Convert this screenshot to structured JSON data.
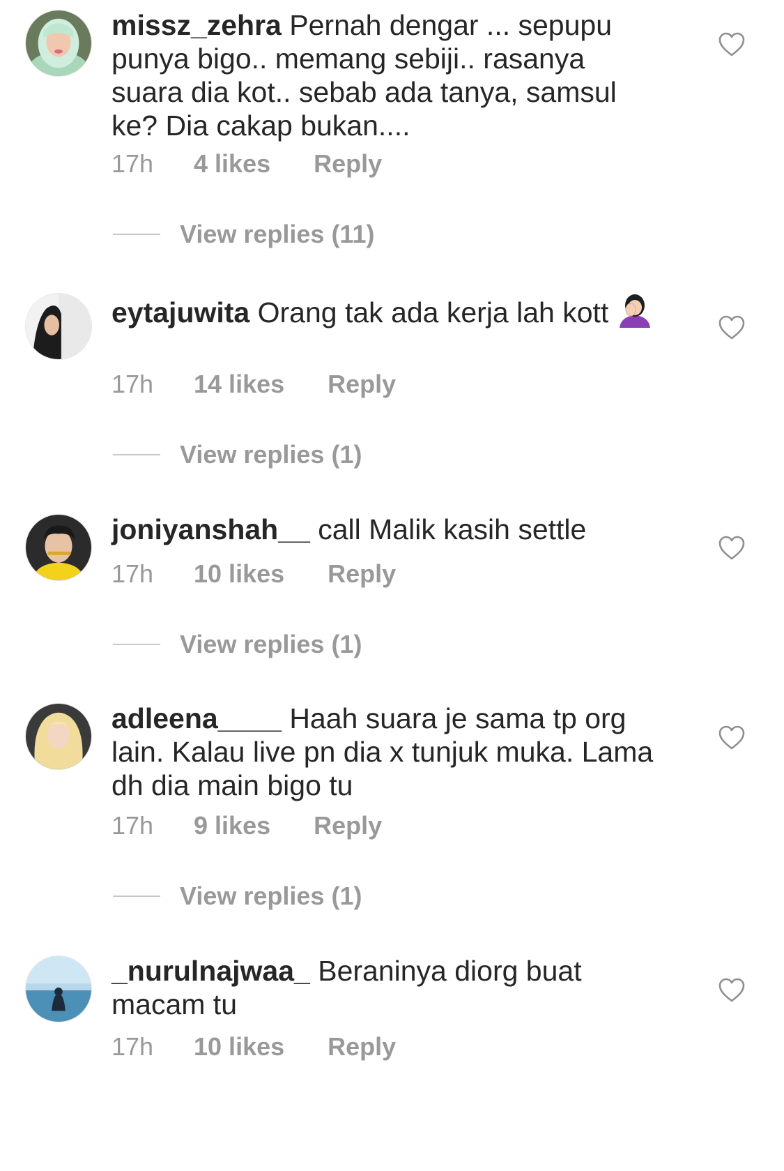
{
  "comments": [
    {
      "username": "missz_zehra",
      "text": "Pernah dengar ... sepupu punya bigo.. memang sebiji.. rasanya suara dia kot.. sebab ada tanya, samsul ke? Dia cakap bukan....",
      "time": "17h",
      "likes": "4 likes",
      "reply": "Reply",
      "view_replies": "View replies (11)",
      "avatar_icon": "avatar-hijab-woman"
    },
    {
      "username": "eytajuwita",
      "text": "Orang tak ada kerja lah kott",
      "emoji": "woman-facepalming-emoji",
      "time": "17h",
      "likes": "14 likes",
      "reply": "Reply",
      "view_replies": "View replies (1)",
      "avatar_icon": "avatar-hijab-woman-black"
    },
    {
      "username": "joniyanshah__",
      "text": "call Malik kasih settle",
      "time": "17h",
      "likes": "10 likes",
      "reply": "Reply",
      "view_replies": "View replies (1)",
      "avatar_icon": "avatar-man-yellow-shirt"
    },
    {
      "username": "adleena____",
      "text": "Haah suara je sama tp org lain. Kalau live pn dia x tunjuk muka. Lama dh dia main bigo tu",
      "time": "17h",
      "likes": "9 likes",
      "reply": "Reply",
      "view_replies": "View replies (1)",
      "avatar_icon": "avatar-blonde-woman"
    },
    {
      "username": "_nurulnajwaa_",
      "text": "Beraninya diorg buat macam tu",
      "time": "17h",
      "likes": "10 likes",
      "reply": "Reply",
      "avatar_icon": "avatar-seaside-person"
    }
  ],
  "icons": {
    "like": "heart-outline-icon"
  },
  "colors": {
    "text": "#262626",
    "meta": "#999999",
    "divider": "#c7c7c7"
  }
}
